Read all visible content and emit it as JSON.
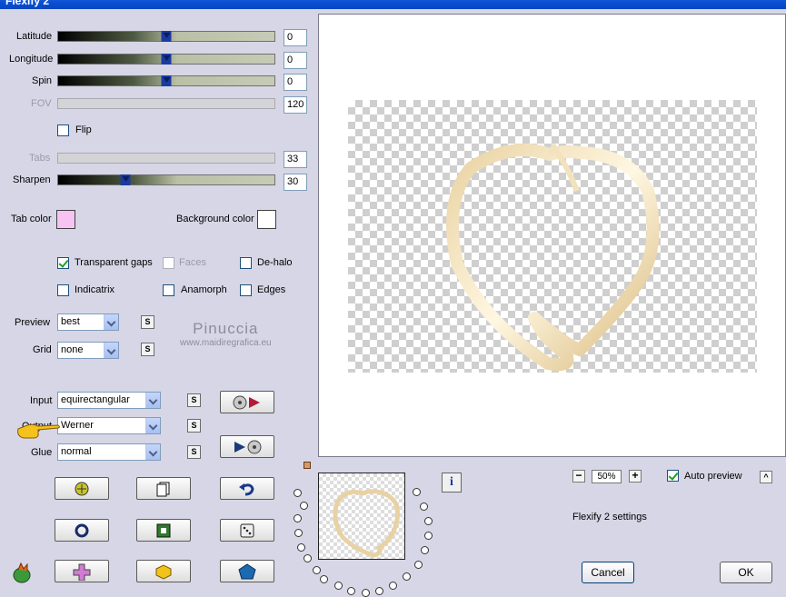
{
  "window": {
    "title": "Flexify 2"
  },
  "sliders": {
    "latitude": {
      "label": "Latitude",
      "value": "0",
      "level": 0.5
    },
    "longitude": {
      "label": "Longitude",
      "value": "0",
      "level": 0.5
    },
    "spin": {
      "label": "Spin",
      "value": "0",
      "level": 0.5
    },
    "fov": {
      "label": "FOV",
      "value": "120"
    },
    "tabs": {
      "label": "Tabs",
      "value": "33"
    },
    "sharpen": {
      "label": "Sharpen",
      "value": "30",
      "level": 0.31
    }
  },
  "flip": {
    "label": "Flip",
    "checked": false
  },
  "colors": {
    "tab_color_label": "Tab color",
    "tab_color": "#f6c3f3",
    "background_color_label": "Background color",
    "background_color": "#ffffff"
  },
  "options": {
    "transparent_gaps": {
      "label": "Transparent gaps",
      "checked": true
    },
    "faces": {
      "label": "Faces",
      "checked": false
    },
    "de_halo": {
      "label": "De-halo",
      "checked": false
    },
    "indicatrix": {
      "label": "Indicatrix",
      "checked": false
    },
    "anamorph": {
      "label": "Anamorph",
      "checked": false
    },
    "edges": {
      "label": "Edges",
      "checked": false
    }
  },
  "preview": {
    "label": "Preview",
    "value": "best"
  },
  "grid": {
    "label": "Grid",
    "value": "none"
  },
  "watermark": {
    "line1": "Pinuccia",
    "line2": "www.maidiregrafica.eu"
  },
  "input": {
    "label": "Input",
    "value": "equirectangular"
  },
  "output": {
    "label": "Output",
    "value": "Werner"
  },
  "glue": {
    "label": "Glue",
    "value": "normal"
  },
  "save_button_label": "S",
  "zoom": {
    "value": "50%",
    "minus": "−",
    "plus": "+"
  },
  "auto_preview": {
    "label": "Auto preview",
    "checked": true
  },
  "collapse_label": "^",
  "info_label": "i",
  "settings_label": "Flexify 2 settings",
  "buttons": {
    "cancel": "Cancel",
    "ok": "OK"
  },
  "accent": "#0a4fd4"
}
